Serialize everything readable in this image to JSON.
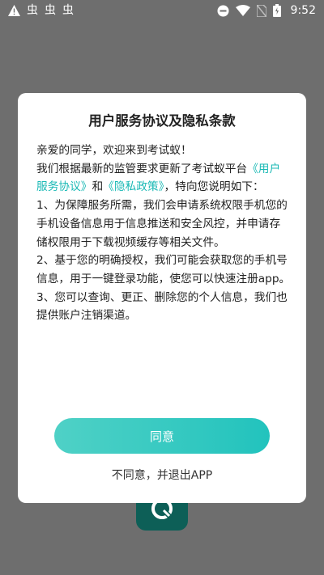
{
  "status_bar": {
    "time": "9:52",
    "notification_icons": [
      "warning-icon",
      "bug-icon",
      "bug-icon",
      "bug-icon"
    ],
    "system_icons": [
      "do-not-disturb-icon",
      "wifi-icon",
      "no-sim-icon",
      "battery-icon"
    ],
    "bug_glyph": "虫"
  },
  "dialog": {
    "title": "用户服务协议及隐私条款",
    "greeting": "亲爱的同学，欢迎来到考试蚁！",
    "intro_prefix": "我们根据最新的监管要求更新了考试蚁平台",
    "link_service": "《用户服务协议》",
    "conjunction": "和",
    "link_privacy": "《隐私政策》",
    "intro_suffix": "，特向您说明如下：",
    "item1": "1、为保障服务所需，我们会申请系统权限手机您的手机设备信息用于信息推送和安全风控，并申请存储权限用于下载视频缓存等相关文件。",
    "item2": "2、基于您的明确授权，我们可能会获取您的手机号信息，用于一键登录功能，使您可以快速注册app。",
    "item3": "3、您可以查询、更正、删除您的个人信息，我们也提供账户注销渠道。",
    "agree_label": "同意",
    "disagree_label": "不同意，并退出APP"
  },
  "colors": {
    "link": "#1ab9b5",
    "button_start": "#4fd1c6",
    "button_end": "#22c3bd",
    "backdrop": "#6e6e6e"
  }
}
